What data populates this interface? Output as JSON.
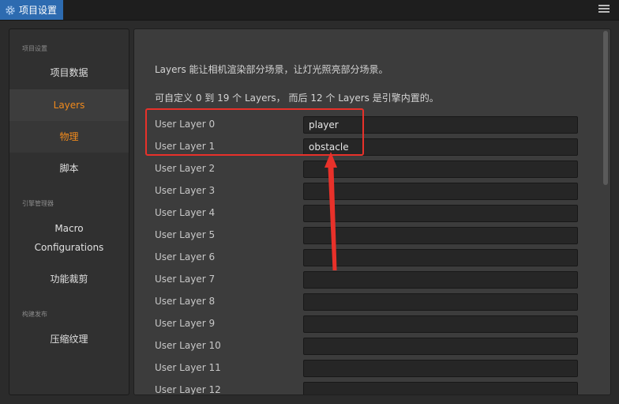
{
  "window": {
    "tab_title": "项目设置",
    "icon": "gear-icon",
    "menu_icon": "hamburger-menu-icon",
    "accent_color": "#2d6bb0"
  },
  "sidebar": {
    "groups": [
      {
        "title": "项目设置",
        "items": [
          {
            "label": "项目数据",
            "state": "normal"
          },
          {
            "label": "Layers",
            "state": "active"
          },
          {
            "label": "物理",
            "state": "hover"
          },
          {
            "label": "脚本",
            "state": "normal"
          }
        ]
      },
      {
        "title": "引擎管理器",
        "items": [
          {
            "label": "Macro\nConfigurations",
            "state": "normal"
          },
          {
            "label": "功能裁剪",
            "state": "normal"
          }
        ]
      },
      {
        "title": "构建发布",
        "items": [
          {
            "label": "压缩纹理",
            "state": "normal"
          }
        ]
      }
    ],
    "active_color": "#f08a1c"
  },
  "main": {
    "description_1": "Layers 能让相机渲染部分场景，让灯光照亮部分场景。",
    "description_2": "可自定义 0 到 19 个 Layers， 而后 12 个 Layers 是引擎内置的。",
    "layers": [
      {
        "label": "User Layer 0",
        "value": "player"
      },
      {
        "label": "User Layer 1",
        "value": "obstacle"
      },
      {
        "label": "User Layer 2",
        "value": ""
      },
      {
        "label": "User Layer 3",
        "value": ""
      },
      {
        "label": "User Layer 4",
        "value": ""
      },
      {
        "label": "User Layer 5",
        "value": ""
      },
      {
        "label": "User Layer 6",
        "value": ""
      },
      {
        "label": "User Layer 7",
        "value": ""
      },
      {
        "label": "User Layer 8",
        "value": ""
      },
      {
        "label": "User Layer 9",
        "value": ""
      },
      {
        "label": "User Layer 10",
        "value": ""
      },
      {
        "label": "User Layer 11",
        "value": ""
      },
      {
        "label": "User Layer 12",
        "value": ""
      }
    ]
  },
  "annotation": {
    "color": "#e8312a"
  }
}
